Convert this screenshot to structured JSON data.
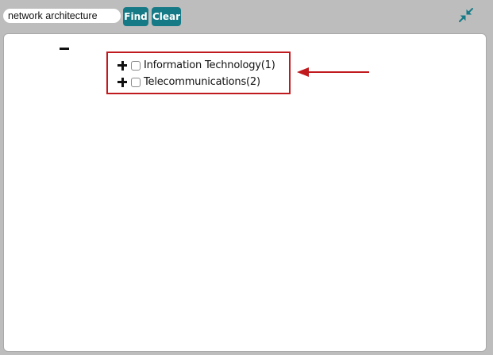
{
  "search": {
    "value": "network architecture",
    "placeholder": ""
  },
  "toolbar": {
    "find_label": "Find",
    "clear_label": "Clear",
    "collapse_icon": "collapse-arrows-icon"
  },
  "tree": {
    "root_toggle_icon": "minus-icon",
    "items": [
      {
        "label": "Information Technology(1)",
        "checked": false,
        "icon": "plus-icon"
      },
      {
        "label": "Telecommunications(2)",
        "checked": false,
        "icon": "plus-icon"
      }
    ]
  },
  "annotation": {
    "color": "#c0191e",
    "type": "red-box-with-arrow"
  },
  "colors": {
    "accent": "#167a86",
    "background": "#bdbdbd",
    "panel": "#ffffff"
  }
}
